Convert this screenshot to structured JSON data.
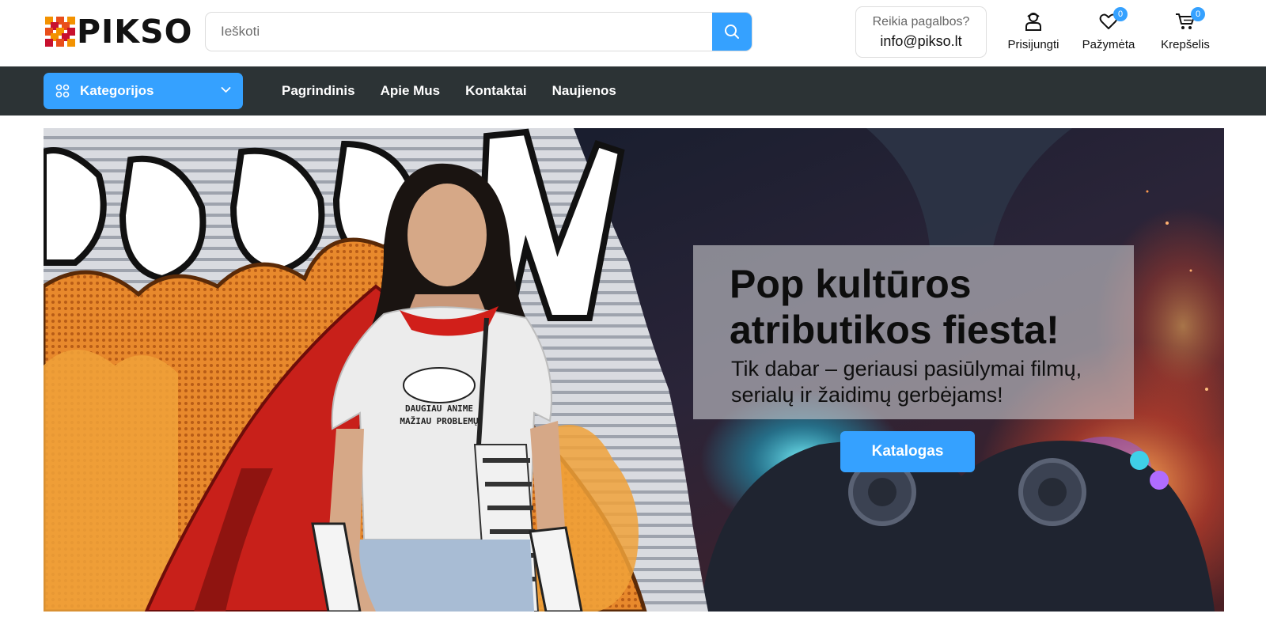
{
  "brand": {
    "name": "PIKSO",
    "logo_colors": [
      "#e94e1b",
      "#f39200",
      "#c8102e"
    ]
  },
  "search": {
    "placeholder": "Ieškoti",
    "value": "",
    "icon": "search-icon"
  },
  "help": {
    "label": "Reikia pagalbos?",
    "email": "info@pikso.lt"
  },
  "header_actions": {
    "login": {
      "label": "Prisijungti",
      "icon": "user-icon"
    },
    "wishlist": {
      "label": "Pažymėta",
      "icon": "heart-icon",
      "count": "0"
    },
    "cart": {
      "label": "Krepšelis",
      "icon": "cart-icon",
      "count": "0"
    }
  },
  "nav": {
    "categories_label": "Kategorijos",
    "links": [
      "Pagrindinis",
      "Apie Mus",
      "Kontaktai",
      "Naujienos"
    ]
  },
  "hero": {
    "title": "Pop kultūros atributikos fiesta!",
    "subtitle": "Tik dabar – geriausi pasiūlymai filmų, serialų ir žaidimų gerbėjams!",
    "button_label": "Katalogas",
    "shirt_text": [
      "DAUGIAU ANIME",
      "MAŽIAU PROBLEMŲ"
    ]
  },
  "colors": {
    "accent": "#35a1ff",
    "nav_bg": "#2c3335",
    "text": "#111111"
  }
}
